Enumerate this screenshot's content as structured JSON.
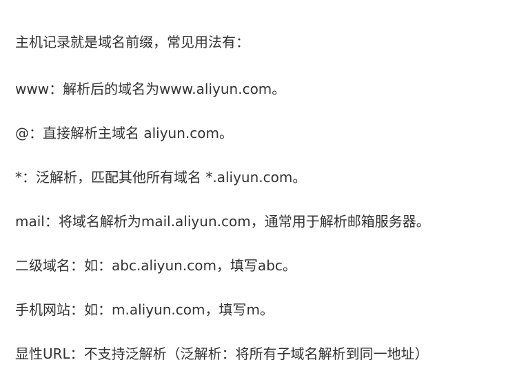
{
  "document": {
    "lines": [
      "主机记录就是域名前缀，常见用法有：",
      "www：解析后的域名为www.aliyun.com。",
      "@：直接解析主域名 aliyun.com。",
      "*：泛解析，匹配其他所有域名 *.aliyun.com。",
      "mail：将域名解析为mail.aliyun.com，通常用于解析邮箱服务器。",
      "二级域名：如：abc.aliyun.com，填写abc。",
      "手机网站：如：m.aliyun.com，填写m。",
      "显性URL：不支持泛解析（泛解析：将所有子域名解析到同一地址）"
    ]
  }
}
